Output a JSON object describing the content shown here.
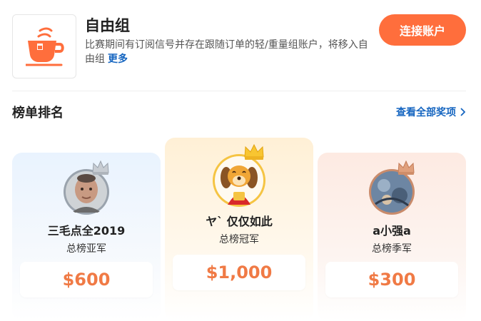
{
  "header": {
    "logo_icon": "teacup-icon",
    "title": "自由组",
    "description": "比赛期间有订阅信号并存在跟随订单的轻/重量组账户，将移入自由组",
    "more_label": "更多",
    "connect_button": "连接账户"
  },
  "leaderboard": {
    "title": "榜单排名",
    "view_all": "查看全部奖项",
    "view_all_icon": "chevron-right-icon",
    "players": [
      {
        "place": 2,
        "name": "三毛点全2019",
        "rank_label": "总榜亚军",
        "prize": "$600",
        "crown": "silver-crown-icon",
        "ring_color": "#9aa3ad"
      },
      {
        "place": 1,
        "name": "ヤ` 仅仅如此",
        "rank_label": "总榜冠军",
        "prize": "$1,000",
        "crown": "gold-crown-icon",
        "ring_color": "#f5c443"
      },
      {
        "place": 3,
        "name": "a小强a",
        "rank_label": "总榜季军",
        "prize": "$300",
        "crown": "bronze-crown-icon",
        "ring_color": "#c98b6b"
      }
    ]
  },
  "colors": {
    "accent": "#ff6e3c",
    "link": "#1565c0",
    "prize": "#f07a45"
  }
}
